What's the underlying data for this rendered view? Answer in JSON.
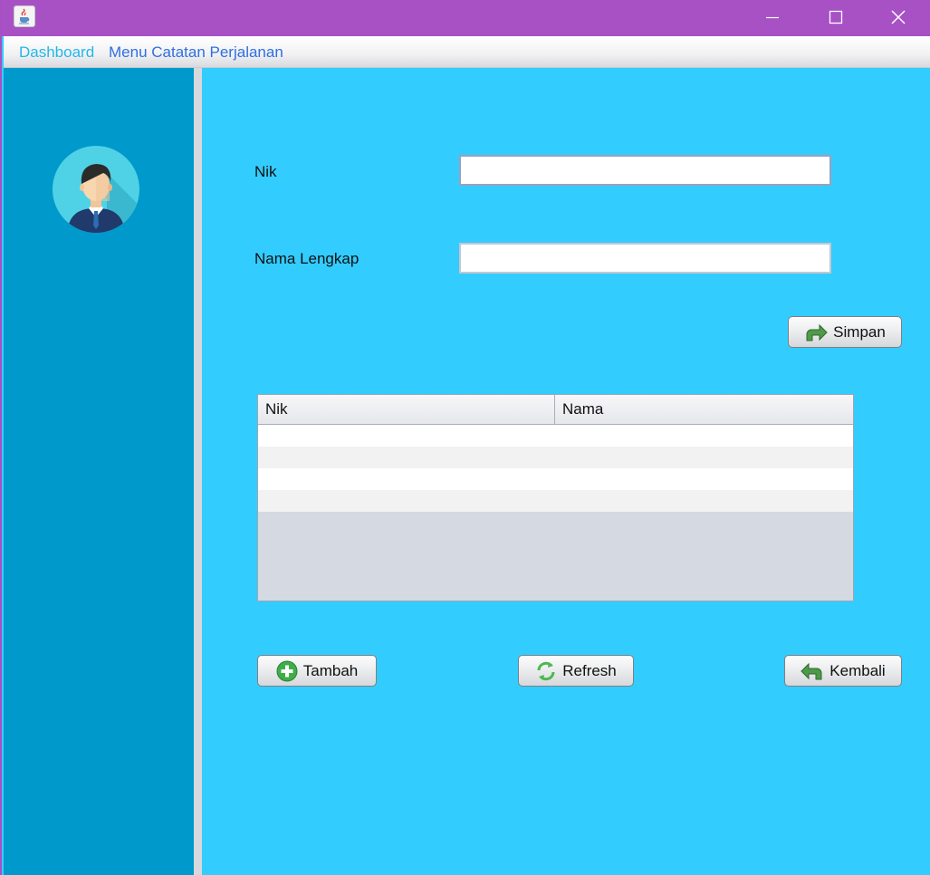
{
  "window": {
    "app_icon": "java-cup-icon",
    "controls": [
      "minimize-icon",
      "maximize-icon",
      "close-icon"
    ]
  },
  "menubar": {
    "items": [
      {
        "label": "Dashboard",
        "color": "#23b8e8"
      },
      {
        "label": "Menu Catatan Perjalanan",
        "color": "#2f6fe0"
      }
    ]
  },
  "sidebar": {
    "avatar_icon": "user-avatar-icon"
  },
  "form": {
    "nik_label": "Nik",
    "nik_value": "",
    "nama_label": "Nama Lengkap",
    "nama_value": ""
  },
  "buttons": {
    "simpan": "Simpan",
    "tambah": "Tambah",
    "refresh": "Refresh",
    "kembali": "Kembali"
  },
  "table": {
    "columns": [
      "Nik",
      "Nama"
    ],
    "rows": [
      [
        "",
        ""
      ],
      [
        "",
        ""
      ],
      [
        "",
        ""
      ],
      [
        "",
        ""
      ]
    ]
  },
  "colors": {
    "titlebar": "#a851c5",
    "sidebar": "#0099cc",
    "main": "#33ccff"
  }
}
